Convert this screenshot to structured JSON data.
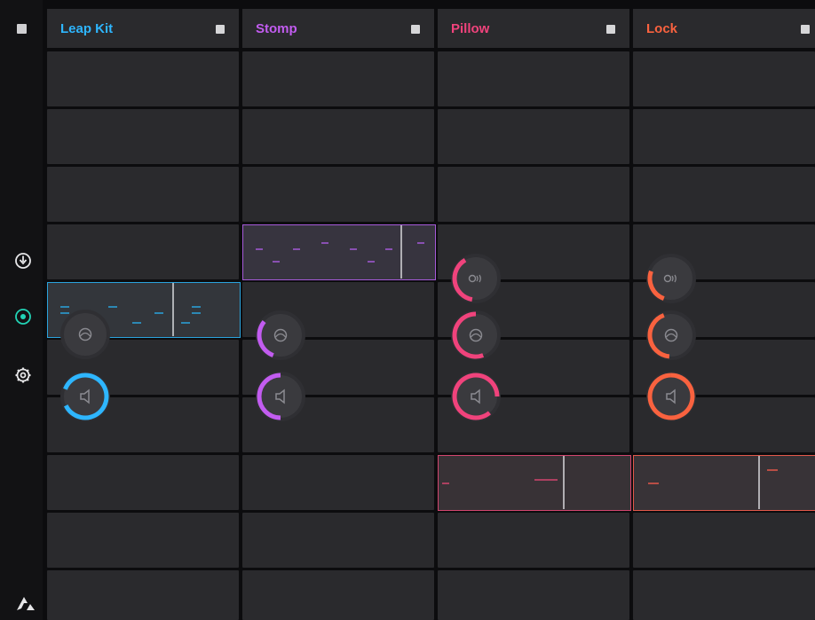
{
  "sidebar": {
    "icons": [
      "record-icon",
      "target-icon",
      "settings-icon"
    ],
    "logo": "app-logo-icon",
    "active_color": "#22d3b5"
  },
  "lanes": [
    {
      "title": "Leap Kit",
      "color": "#2eb6ff"
    },
    {
      "title": "Stomp",
      "color": "#c25cf0"
    },
    {
      "title": "Pillow",
      "color": "#f0437c"
    },
    {
      "title": "Lock",
      "color": "#f9623f"
    }
  ],
  "knob_colors": {
    "Leap Kit": "#2eb6ff",
    "Stomp": "#c25cf0",
    "Pillow": "#f0437c",
    "Lock": "#f9623f"
  }
}
